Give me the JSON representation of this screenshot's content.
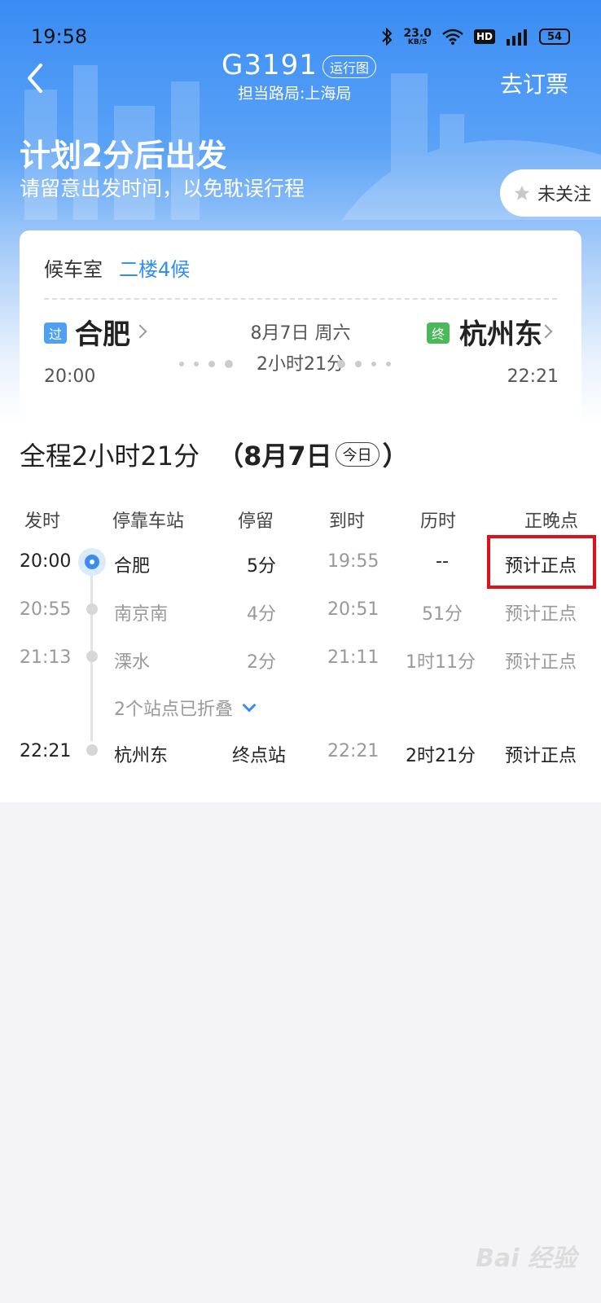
{
  "status_bar": {
    "time": "19:58",
    "net_speed_value": "23.0",
    "net_speed_unit": "KB/S",
    "hd": "HD",
    "network": "4G",
    "battery": "54"
  },
  "header": {
    "train_number": "G3191",
    "route_map_label": "运行图",
    "bureau": "担当路局:上海局",
    "book_label": "去订票"
  },
  "hero": {
    "title": "计划2分后出发",
    "subtitle": "请留意出发时间，以免耽误行程",
    "follow_label": "未关注"
  },
  "card": {
    "waiting_room_label": "候车室",
    "waiting_room_value": "二楼4候",
    "from_tag": "过",
    "from_station": "合肥",
    "from_time": "20:00",
    "to_tag": "终",
    "to_station": "杭州东",
    "to_time": "22:21",
    "date": "8月7日 周六",
    "duration": "2小时21分"
  },
  "summary": {
    "total": "全程2小时21分",
    "open_paren": "（",
    "date": "8月7日",
    "today": "今日",
    "close_paren": "）"
  },
  "table": {
    "headers": [
      "发时",
      "停靠车站",
      "停留",
      "到时",
      "历时",
      "正晚点"
    ],
    "rows": [
      {
        "depart": "20:00",
        "station": "合肥",
        "stop": "5分",
        "arrive": "19:55",
        "elapsed": "--",
        "status": "预计正点"
      },
      {
        "depart": "20:55",
        "station": "南京南",
        "stop": "4分",
        "arrive": "20:51",
        "elapsed": "51分",
        "status": "预计正点"
      },
      {
        "depart": "21:13",
        "station": "溧水",
        "stop": "2分",
        "arrive": "21:11",
        "elapsed": "1时11分",
        "status": "预计正点"
      },
      {
        "depart": "22:21",
        "station": "杭州东",
        "stop": "终点站",
        "arrive": "22:21",
        "elapsed": "2时21分",
        "status": "预计正点"
      }
    ],
    "collapsed_label": "2个站点已折叠"
  },
  "watermark": "Bai 经验",
  "colors": {
    "accent": "#3c8cf0",
    "highlight": "#e0101a",
    "end_tag": "#49b95a"
  }
}
